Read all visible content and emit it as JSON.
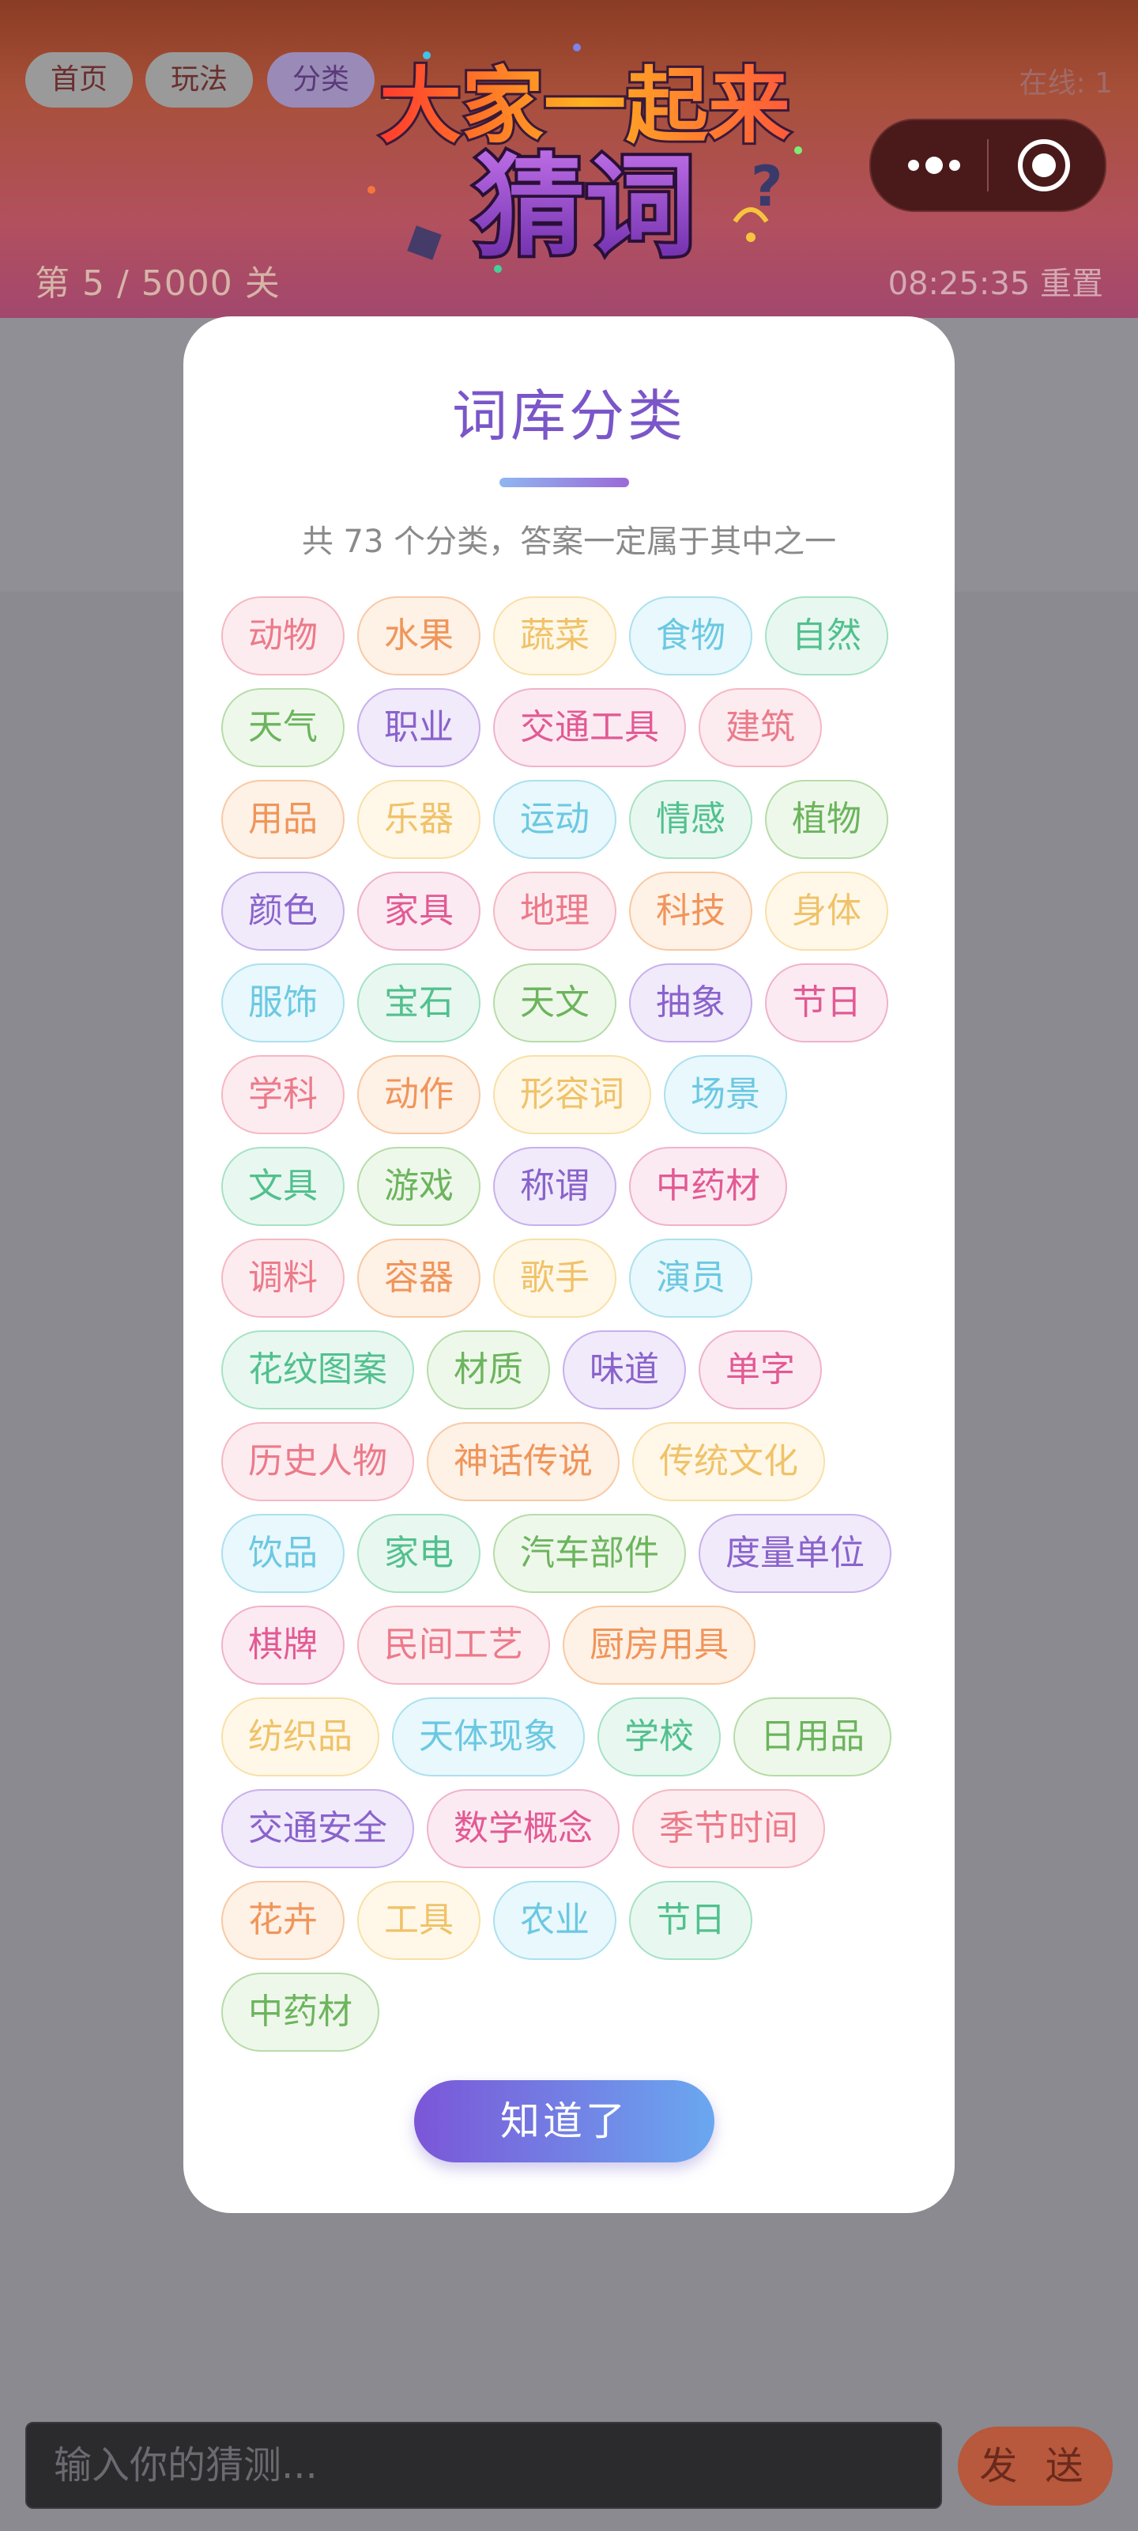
{
  "header": {
    "nav": [
      "首页",
      "玩法",
      "分类"
    ],
    "online": "在线: 1",
    "logo_line1": "大家一起来",
    "logo_line2": "猜词",
    "level": "第 5 / 5000 关",
    "timer": "08:25:35 重置"
  },
  "capsule": {
    "more_icon": "more-dots-icon",
    "target_icon": "target-circle-icon"
  },
  "modal": {
    "title": "词库分类",
    "subtitle": "共 73 个分类，答案一定属于其中之一",
    "ok": "知道了"
  },
  "categories": [
    "动物",
    "水果",
    "蔬菜",
    "食物",
    "自然",
    "天气",
    "职业",
    "交通工具",
    "建筑",
    "用品",
    "乐器",
    "运动",
    "情感",
    "植物",
    "颜色",
    "家具",
    "地理",
    "科技",
    "身体",
    "服饰",
    "宝石",
    "天文",
    "抽象",
    "节日",
    "学科",
    "动作",
    "形容词",
    "场景",
    "文具",
    "游戏",
    "称谓",
    "中药材",
    "调料",
    "容器",
    "歌手",
    "演员",
    "花纹图案",
    "材质",
    "味道",
    "单字",
    "历史人物",
    "神话传说",
    "传统文化",
    "饮品",
    "家电",
    "汽车部件",
    "度量单位",
    "棋牌",
    "民间工艺",
    "厨房用具",
    "纺织品",
    "天体现象",
    "学校",
    "日用品",
    "交通安全",
    "数学概念",
    "季节时间",
    "花卉",
    "工具",
    "农业",
    "节日",
    "中药材"
  ],
  "input": {
    "placeholder": "输入你的猜测..."
  },
  "send_label": "发 送",
  "colors": {
    "accent": "#7a56c8",
    "button_start": "#7b56d8",
    "button_end": "#6aa8f0",
    "send": "#b8583c"
  }
}
